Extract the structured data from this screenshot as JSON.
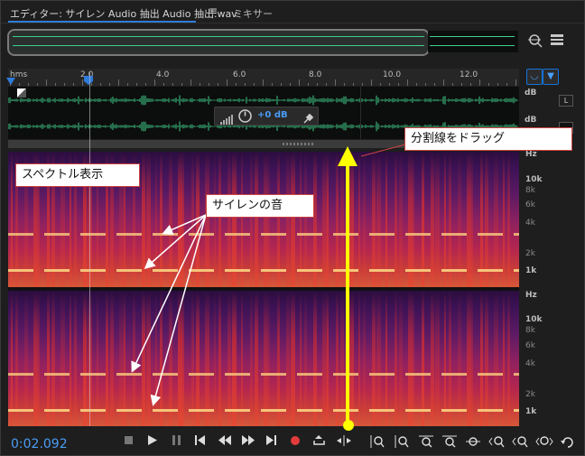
{
  "tabs": {
    "editor": "エディター: サイレン Audio 抽出 Audio 抽出.wav",
    "menu_glyph": "≡",
    "mixer": "ミキサー"
  },
  "ruler": {
    "unit": "hms",
    "labels": [
      "2.0",
      "4.0",
      "6.0",
      "8.0",
      "10.0",
      "12.0"
    ]
  },
  "waveform": {
    "db_label_top": "dB",
    "db_label_bottom": "dB",
    "channel_left": "L",
    "hud_gain": "+0 dB"
  },
  "spectral": {
    "hz_label": "Hz",
    "ticks": [
      "10k",
      "8k",
      "6k",
      "4k",
      "2k",
      "1k"
    ]
  },
  "annotations": {
    "divider": "分割線をドラッグ",
    "spectral_view": "スペクトル表示",
    "siren": "サイレンの音"
  },
  "transport": {
    "timecode": "0:02.092"
  },
  "colors": {
    "accent": "#2f7bd8",
    "wave": "#3fcf8a",
    "arrow": "#ffff00",
    "harmonic": "#f6c37a"
  }
}
